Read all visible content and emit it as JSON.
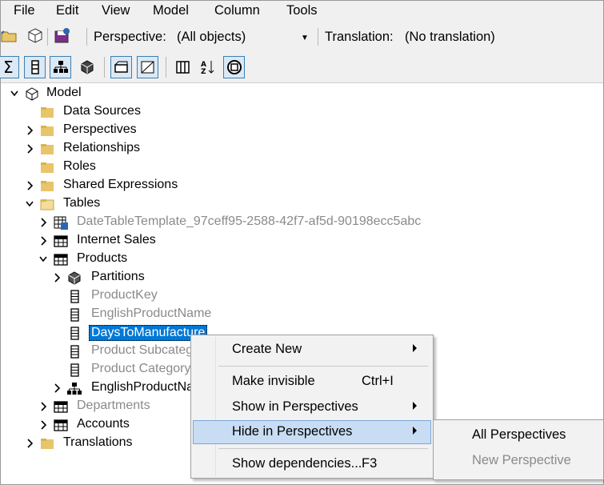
{
  "menu": [
    "File",
    "Edit",
    "View",
    "Model",
    "Column",
    "Tools"
  ],
  "toolbar": {
    "perspective_label": "Perspective:",
    "perspective_value": "(All objects)",
    "translation_label": "Translation:",
    "translation_value": "(No translation)"
  },
  "tree": {
    "model": "Model",
    "data_sources": "Data Sources",
    "perspectives": "Perspectives",
    "relationships": "Relationships",
    "roles": "Roles",
    "shared_expressions": "Shared Expressions",
    "tables": "Tables",
    "date_table": "DateTableTemplate_97ceff95-2588-42f7-af5d-90198ecc5abc",
    "internet_sales": "Internet Sales",
    "products": "Products",
    "partitions": "Partitions",
    "product_key": "ProductKey",
    "english_product_name": "EnglishProductName",
    "days_to_manufacture": "DaysToManufacture",
    "product_subcategory": "Product Subcateg",
    "product_category": "Product Category",
    "english_product_name_h": "EnglishProductNa",
    "departments": "Departments",
    "accounts": "Accounts",
    "translations": "Translations"
  },
  "context_menu": {
    "create_new": "Create New",
    "make_invisible": "Make invisible",
    "make_invisible_shortcut": "Ctrl+I",
    "show_in_perspectives": "Show in Perspectives",
    "hide_in_perspectives": "Hide in Perspectives",
    "show_dependencies": "Show dependencies...",
    "show_dependencies_shortcut": "F3"
  },
  "submenu": {
    "all_perspectives": "All Perspectives",
    "new_perspective": "New Perspective"
  },
  "colors": {
    "selection": "#0078d7",
    "menu_highlight": "#c8ddf3",
    "folder": "#e8c56a",
    "disabled_text": "#8a8a8a"
  }
}
